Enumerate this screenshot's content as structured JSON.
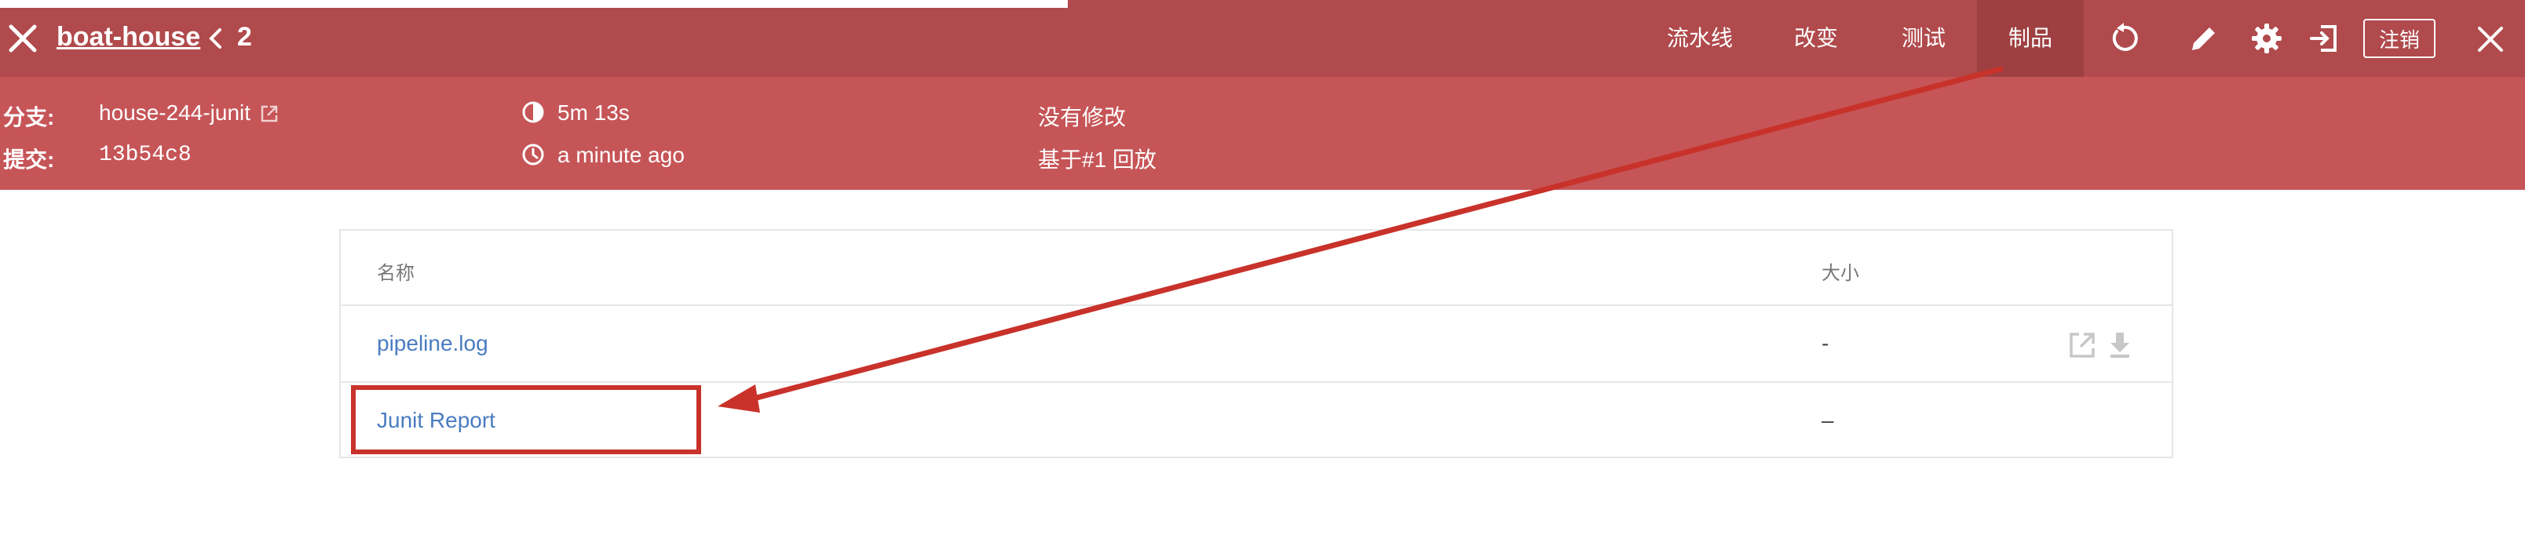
{
  "header": {
    "title": "boat-house",
    "run_number": "2",
    "tabs": [
      {
        "label": "流水线",
        "active": false
      },
      {
        "label": "改变",
        "active": false
      },
      {
        "label": "测试",
        "active": false
      },
      {
        "label": "制品",
        "active": true
      }
    ],
    "icons": [
      "close-icon",
      "chevron-left-icon",
      "replay-icon",
      "edit-pencil-icon",
      "settings-gear-icon",
      "sign-out-icon",
      "close-icon"
    ],
    "logout_label": "注销"
  },
  "info": {
    "branch_label": "分支:",
    "branch_value": "house-244-junit",
    "commit_label": "提交:",
    "commit_value": "13b54c8",
    "duration": "5m 13s",
    "time_ago": "a minute ago",
    "changes": "没有修改",
    "replay_of": "基于#1 回放"
  },
  "artifacts": {
    "columns": [
      "名称",
      "大小"
    ],
    "rows": [
      {
        "name": "pipeline.log",
        "size": "-"
      },
      {
        "name": "Junit Report",
        "size": "–"
      }
    ]
  },
  "annotation": {
    "highlight_color": "#c8322a",
    "arrow_color": "#c8322a"
  },
  "colors": {
    "topbar": "#b04a4c",
    "active_tab": "#9e4042",
    "infobar": "#c65557",
    "link": "#4a7cc0"
  }
}
